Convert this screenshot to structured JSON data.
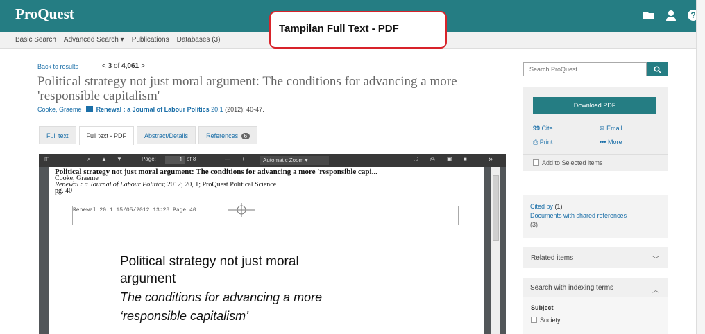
{
  "brand": {
    "logo": "ProQuest"
  },
  "top_icons": [
    "folder-icon",
    "user-icon",
    "help-icon"
  ],
  "annotation": "Tampilan Full Text - PDF",
  "nav": {
    "basic_search": "Basic Search",
    "advanced_search": "Advanced Search",
    "advanced_caret": "▾",
    "publications": "Publications",
    "databases": "Databases (3)"
  },
  "record": {
    "back_link": "Back to results",
    "pager_prev": "<",
    "pager_current": "3",
    "pager_of": "of",
    "pager_total": "4,061",
    "pager_next": ">",
    "title": "Political strategy not just moral argument: The conditions for advancing a more 'responsible capitalism'",
    "author": "Cooke, Graeme",
    "journal": "Renewal : a Journal of Labour Politics",
    "volume": "20.1",
    "year_pages": "(2012): 40-47."
  },
  "tabs": [
    {
      "label": "Full text",
      "active": false
    },
    {
      "label": "Full text - PDF",
      "active": true
    },
    {
      "label": "Abstract/Details",
      "active": false
    },
    {
      "label": "References",
      "active": false,
      "badge": "6"
    }
  ],
  "viewer": {
    "page_label": "Page:",
    "page_value": "1",
    "page_of": "of 8",
    "zoom_label": "Automatic Zoom",
    "minus": "—",
    "plus": "+",
    "more": "»",
    "pdf_header_title": "Political strategy not just moral argument: The conditions for advancing a more 'responsible capi...",
    "pdf_header_author": "Cooke, Graeme",
    "pdf_header_journal": "Renewal : a Journal of Labour Politics",
    "pdf_header_source": "; 2012; 20, 1; ProQuest Political Science",
    "pdf_header_page": "pg. 40",
    "scan_line": "Renewal 20.1   15/05/2012   13:28   Page 40",
    "article_line1": "Political strategy not just moral",
    "article_line2": "argument",
    "article_line3": "The conditions for advancing a more",
    "article_line4": "‘responsible capitalism’"
  },
  "sidebar": {
    "search_placeholder": "Search ProQuest...",
    "download_label": "Download PDF",
    "cite": "Cite",
    "cite_glyph": "99",
    "email": "Email",
    "print": "Print",
    "more": "More",
    "more_glyph": "•••",
    "add_selected": "Add to Selected items",
    "cited_by": "Cited by",
    "cited_by_count": "(1)",
    "shared_refs": "Documents with shared references",
    "shared_refs_count": "(3)",
    "related_items": "Related items",
    "indexing_terms": "Search with indexing terms",
    "subject_label": "Subject",
    "subject_item": "Society"
  },
  "colors": {
    "brand_teal": "#257d83",
    "link_blue": "#1b6fa8",
    "callout_red": "#d8232a"
  }
}
